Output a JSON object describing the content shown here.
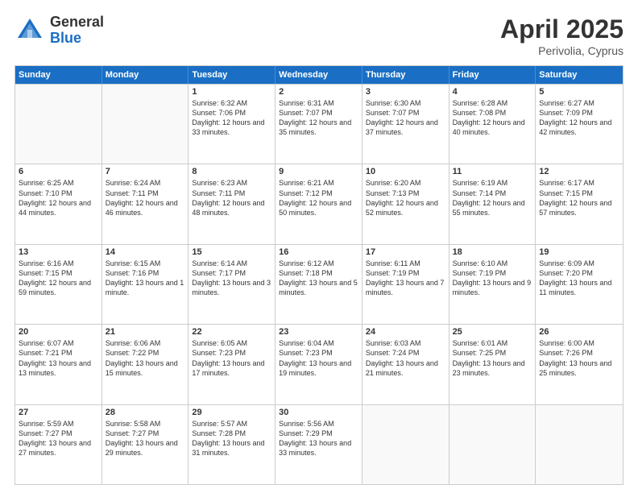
{
  "logo": {
    "general": "General",
    "blue": "Blue"
  },
  "title": {
    "month": "April 2025",
    "location": "Perivolia, Cyprus"
  },
  "header_days": [
    "Sunday",
    "Monday",
    "Tuesday",
    "Wednesday",
    "Thursday",
    "Friday",
    "Saturday"
  ],
  "rows": [
    [
      {
        "day": "",
        "text": "",
        "empty": true
      },
      {
        "day": "",
        "text": "",
        "empty": true
      },
      {
        "day": "1",
        "text": "Sunrise: 6:32 AM\nSunset: 7:06 PM\nDaylight: 12 hours and 33 minutes.",
        "empty": false
      },
      {
        "day": "2",
        "text": "Sunrise: 6:31 AM\nSunset: 7:07 PM\nDaylight: 12 hours and 35 minutes.",
        "empty": false
      },
      {
        "day": "3",
        "text": "Sunrise: 6:30 AM\nSunset: 7:07 PM\nDaylight: 12 hours and 37 minutes.",
        "empty": false
      },
      {
        "day": "4",
        "text": "Sunrise: 6:28 AM\nSunset: 7:08 PM\nDaylight: 12 hours and 40 minutes.",
        "empty": false
      },
      {
        "day": "5",
        "text": "Sunrise: 6:27 AM\nSunset: 7:09 PM\nDaylight: 12 hours and 42 minutes.",
        "empty": false
      }
    ],
    [
      {
        "day": "6",
        "text": "Sunrise: 6:25 AM\nSunset: 7:10 PM\nDaylight: 12 hours and 44 minutes.",
        "empty": false
      },
      {
        "day": "7",
        "text": "Sunrise: 6:24 AM\nSunset: 7:11 PM\nDaylight: 12 hours and 46 minutes.",
        "empty": false
      },
      {
        "day": "8",
        "text": "Sunrise: 6:23 AM\nSunset: 7:11 PM\nDaylight: 12 hours and 48 minutes.",
        "empty": false
      },
      {
        "day": "9",
        "text": "Sunrise: 6:21 AM\nSunset: 7:12 PM\nDaylight: 12 hours and 50 minutes.",
        "empty": false
      },
      {
        "day": "10",
        "text": "Sunrise: 6:20 AM\nSunset: 7:13 PM\nDaylight: 12 hours and 52 minutes.",
        "empty": false
      },
      {
        "day": "11",
        "text": "Sunrise: 6:19 AM\nSunset: 7:14 PM\nDaylight: 12 hours and 55 minutes.",
        "empty": false
      },
      {
        "day": "12",
        "text": "Sunrise: 6:17 AM\nSunset: 7:15 PM\nDaylight: 12 hours and 57 minutes.",
        "empty": false
      }
    ],
    [
      {
        "day": "13",
        "text": "Sunrise: 6:16 AM\nSunset: 7:15 PM\nDaylight: 12 hours and 59 minutes.",
        "empty": false
      },
      {
        "day": "14",
        "text": "Sunrise: 6:15 AM\nSunset: 7:16 PM\nDaylight: 13 hours and 1 minute.",
        "empty": false
      },
      {
        "day": "15",
        "text": "Sunrise: 6:14 AM\nSunset: 7:17 PM\nDaylight: 13 hours and 3 minutes.",
        "empty": false
      },
      {
        "day": "16",
        "text": "Sunrise: 6:12 AM\nSunset: 7:18 PM\nDaylight: 13 hours and 5 minutes.",
        "empty": false
      },
      {
        "day": "17",
        "text": "Sunrise: 6:11 AM\nSunset: 7:19 PM\nDaylight: 13 hours and 7 minutes.",
        "empty": false
      },
      {
        "day": "18",
        "text": "Sunrise: 6:10 AM\nSunset: 7:19 PM\nDaylight: 13 hours and 9 minutes.",
        "empty": false
      },
      {
        "day": "19",
        "text": "Sunrise: 6:09 AM\nSunset: 7:20 PM\nDaylight: 13 hours and 11 minutes.",
        "empty": false
      }
    ],
    [
      {
        "day": "20",
        "text": "Sunrise: 6:07 AM\nSunset: 7:21 PM\nDaylight: 13 hours and 13 minutes.",
        "empty": false
      },
      {
        "day": "21",
        "text": "Sunrise: 6:06 AM\nSunset: 7:22 PM\nDaylight: 13 hours and 15 minutes.",
        "empty": false
      },
      {
        "day": "22",
        "text": "Sunrise: 6:05 AM\nSunset: 7:23 PM\nDaylight: 13 hours and 17 minutes.",
        "empty": false
      },
      {
        "day": "23",
        "text": "Sunrise: 6:04 AM\nSunset: 7:23 PM\nDaylight: 13 hours and 19 minutes.",
        "empty": false
      },
      {
        "day": "24",
        "text": "Sunrise: 6:03 AM\nSunset: 7:24 PM\nDaylight: 13 hours and 21 minutes.",
        "empty": false
      },
      {
        "day": "25",
        "text": "Sunrise: 6:01 AM\nSunset: 7:25 PM\nDaylight: 13 hours and 23 minutes.",
        "empty": false
      },
      {
        "day": "26",
        "text": "Sunrise: 6:00 AM\nSunset: 7:26 PM\nDaylight: 13 hours and 25 minutes.",
        "empty": false
      }
    ],
    [
      {
        "day": "27",
        "text": "Sunrise: 5:59 AM\nSunset: 7:27 PM\nDaylight: 13 hours and 27 minutes.",
        "empty": false
      },
      {
        "day": "28",
        "text": "Sunrise: 5:58 AM\nSunset: 7:27 PM\nDaylight: 13 hours and 29 minutes.",
        "empty": false
      },
      {
        "day": "29",
        "text": "Sunrise: 5:57 AM\nSunset: 7:28 PM\nDaylight: 13 hours and 31 minutes.",
        "empty": false
      },
      {
        "day": "30",
        "text": "Sunrise: 5:56 AM\nSunset: 7:29 PM\nDaylight: 13 hours and 33 minutes.",
        "empty": false
      },
      {
        "day": "",
        "text": "",
        "empty": true
      },
      {
        "day": "",
        "text": "",
        "empty": true
      },
      {
        "day": "",
        "text": "",
        "empty": true
      }
    ]
  ]
}
